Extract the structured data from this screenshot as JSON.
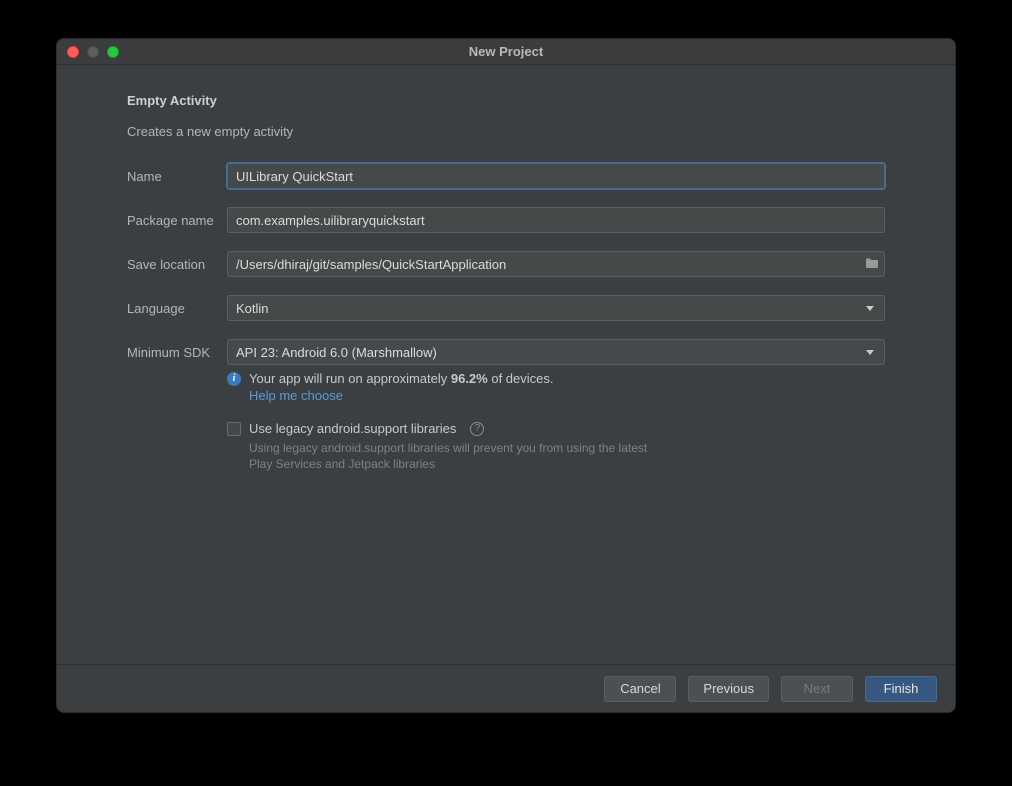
{
  "window": {
    "title": "New Project"
  },
  "heading": "Empty Activity",
  "subtitle": "Creates a new empty activity",
  "form": {
    "name_label": "Name",
    "name_value": "UILibrary QuickStart",
    "package_label": "Package name",
    "package_value": "com.examples.uilibraryquickstart",
    "save_label": "Save location",
    "save_value": "/Users/dhiraj/git/samples/QuickStartApplication",
    "language_label": "Language",
    "language_value": "Kotlin",
    "minsdk_label": "Minimum SDK",
    "minsdk_value": "API 23: Android 6.0 (Marshmallow)"
  },
  "info": {
    "prefix": "Your app will run on approximately ",
    "percent": "96.2%",
    "suffix": " of devices.",
    "help_link": "Help me choose"
  },
  "legacy": {
    "label": "Use legacy android.support libraries",
    "help": "Using legacy android.support libraries will prevent you from using the latest Play Services and Jetpack libraries"
  },
  "buttons": {
    "cancel": "Cancel",
    "previous": "Previous",
    "next": "Next",
    "finish": "Finish"
  }
}
